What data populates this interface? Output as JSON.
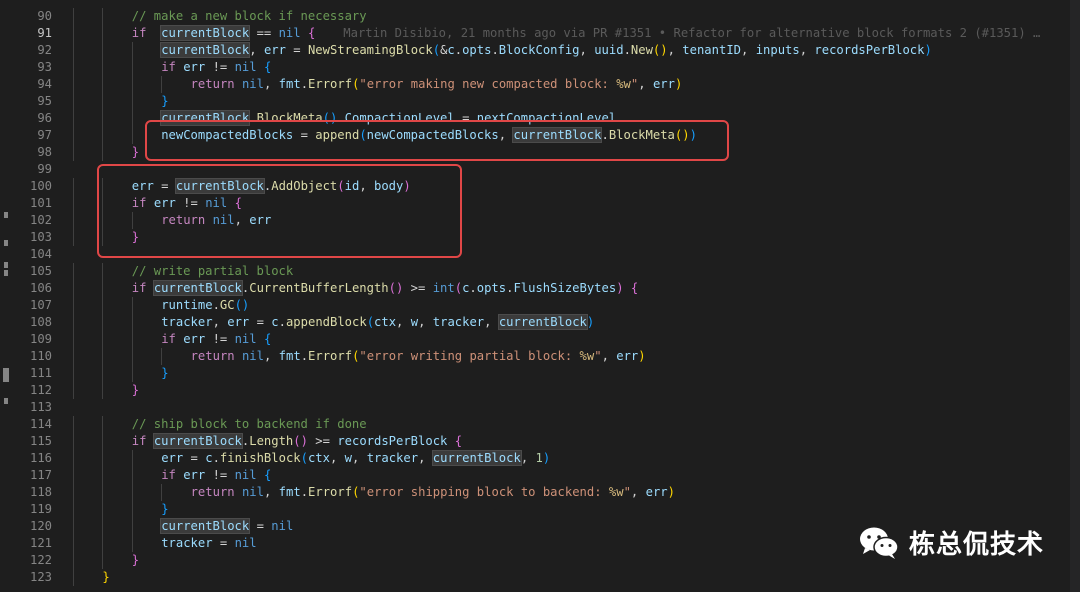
{
  "watermark": {
    "text": "栋总侃技术",
    "icon": "wechat-icon"
  },
  "blame": "Martin Disibio, 21 months ago via PR #1351 • Refactor for alternative block formats 2 (#1351) …",
  "lines": [
    {
      "n": "90",
      "indent": 2,
      "t": [
        [
          "cmt",
          "// make a new block if necessary"
        ]
      ]
    },
    {
      "n": "91",
      "indent": 2,
      "active": true,
      "t": [
        [
          "ctl",
          "if"
        ],
        [
          "",
          "  "
        ],
        [
          "var hl",
          "currentBlock"
        ],
        [
          "",
          " == "
        ],
        [
          "kw",
          "nil"
        ],
        [
          "",
          " "
        ],
        [
          "br2",
          "{"
        ]
      ],
      "blame": true
    },
    {
      "n": "92",
      "indent": 3,
      "t": [
        [
          "var hl",
          "currentBlock"
        ],
        [
          "",
          ", "
        ],
        [
          "var",
          "err"
        ],
        [
          "",
          " = "
        ],
        [
          "fn",
          "NewStreamingBlock"
        ],
        [
          "br3",
          "("
        ],
        [
          "",
          "&"
        ],
        [
          "var",
          "c"
        ],
        [
          "",
          "."
        ],
        [
          "var",
          "opts"
        ],
        [
          "",
          "."
        ],
        [
          "var",
          "BlockConfig"
        ],
        [
          "",
          ", "
        ],
        [
          "var",
          "uuid"
        ],
        [
          "",
          "."
        ],
        [
          "fn",
          "New"
        ],
        [
          "br1",
          "()"
        ],
        [
          "",
          ", "
        ],
        [
          "var",
          "tenantID"
        ],
        [
          "",
          ", "
        ],
        [
          "var",
          "inputs"
        ],
        [
          "",
          ", "
        ],
        [
          "var",
          "recordsPerBlock"
        ],
        [
          "br3",
          ")"
        ]
      ]
    },
    {
      "n": "93",
      "indent": 3,
      "t": [
        [
          "ctl",
          "if"
        ],
        [
          "",
          " "
        ],
        [
          "var",
          "err"
        ],
        [
          "",
          " != "
        ],
        [
          "kw",
          "nil"
        ],
        [
          "",
          " "
        ],
        [
          "br3",
          "{"
        ]
      ]
    },
    {
      "n": "94",
      "indent": 4,
      "t": [
        [
          "ctl",
          "return"
        ],
        [
          "",
          " "
        ],
        [
          "kw",
          "nil"
        ],
        [
          "",
          ", "
        ],
        [
          "var",
          "fmt"
        ],
        [
          "",
          "."
        ],
        [
          "fn",
          "Errorf"
        ],
        [
          "br1",
          "("
        ],
        [
          "str",
          "\"error making new compacted block: "
        ],
        [
          "esc",
          "%w"
        ],
        [
          "str",
          "\""
        ],
        [
          "",
          ", "
        ],
        [
          "var",
          "err"
        ],
        [
          "br1",
          ")"
        ]
      ]
    },
    {
      "n": "95",
      "indent": 3,
      "t": [
        [
          "br3",
          "}"
        ]
      ]
    },
    {
      "n": "96",
      "indent": 3,
      "t": [
        [
          "var hl",
          "currentBlock"
        ],
        [
          "",
          "."
        ],
        [
          "fn",
          "BlockMeta"
        ],
        [
          "br3",
          "()"
        ],
        [
          "",
          "."
        ],
        [
          "var",
          "CompactionLevel"
        ],
        [
          "",
          " = "
        ],
        [
          "var",
          "nextCompactionLevel"
        ]
      ]
    },
    {
      "n": "97",
      "indent": 3,
      "t": [
        [
          "var",
          "newCompactedBlocks"
        ],
        [
          "",
          " = "
        ],
        [
          "fn",
          "append"
        ],
        [
          "br3",
          "("
        ],
        [
          "var",
          "newCompactedBlocks"
        ],
        [
          "",
          ", "
        ],
        [
          "var hl",
          "currentBlock"
        ],
        [
          "",
          "."
        ],
        [
          "fn",
          "BlockMeta"
        ],
        [
          "br1",
          "()"
        ],
        [
          "br3",
          ")"
        ]
      ]
    },
    {
      "n": "98",
      "indent": 2,
      "t": [
        [
          "br2",
          "}"
        ]
      ]
    },
    {
      "n": "99",
      "indent": 0,
      "t": []
    },
    {
      "n": "100",
      "indent": 2,
      "t": [
        [
          "var",
          "err"
        ],
        [
          "",
          " = "
        ],
        [
          "var hl",
          "currentBlock"
        ],
        [
          "",
          "."
        ],
        [
          "fn",
          "AddObject"
        ],
        [
          "br2",
          "("
        ],
        [
          "var",
          "id"
        ],
        [
          "",
          ", "
        ],
        [
          "var",
          "body"
        ],
        [
          "br2",
          ")"
        ]
      ]
    },
    {
      "n": "101",
      "indent": 2,
      "t": [
        [
          "ctl",
          "if"
        ],
        [
          "",
          " "
        ],
        [
          "var",
          "err"
        ],
        [
          "",
          " != "
        ],
        [
          "kw",
          "nil"
        ],
        [
          "",
          " "
        ],
        [
          "br2",
          "{"
        ]
      ]
    },
    {
      "n": "102",
      "indent": 3,
      "t": [
        [
          "ctl",
          "return"
        ],
        [
          "",
          " "
        ],
        [
          "kw",
          "nil"
        ],
        [
          "",
          ", "
        ],
        [
          "var",
          "err"
        ]
      ]
    },
    {
      "n": "103",
      "indent": 2,
      "t": [
        [
          "br2",
          "}"
        ]
      ]
    },
    {
      "n": "104",
      "indent": 0,
      "t": []
    },
    {
      "n": "105",
      "indent": 2,
      "t": [
        [
          "cmt",
          "// write partial block"
        ]
      ]
    },
    {
      "n": "106",
      "indent": 2,
      "t": [
        [
          "ctl",
          "if"
        ],
        [
          "",
          " "
        ],
        [
          "var hl",
          "currentBlock"
        ],
        [
          "",
          "."
        ],
        [
          "fn",
          "CurrentBufferLength"
        ],
        [
          "br2",
          "()"
        ],
        [
          "",
          " >= "
        ],
        [
          "kw",
          "int"
        ],
        [
          "br2",
          "("
        ],
        [
          "var",
          "c"
        ],
        [
          "",
          "."
        ],
        [
          "var",
          "opts"
        ],
        [
          "",
          "."
        ],
        [
          "var",
          "FlushSizeBytes"
        ],
        [
          "br2",
          ")"
        ],
        [
          "",
          " "
        ],
        [
          "br2",
          "{"
        ]
      ]
    },
    {
      "n": "107",
      "indent": 3,
      "t": [
        [
          "var",
          "runtime"
        ],
        [
          "",
          "."
        ],
        [
          "fn",
          "GC"
        ],
        [
          "br3",
          "()"
        ]
      ]
    },
    {
      "n": "108",
      "indent": 3,
      "t": [
        [
          "var",
          "tracker"
        ],
        [
          "",
          ", "
        ],
        [
          "var",
          "err"
        ],
        [
          "",
          " = "
        ],
        [
          "var",
          "c"
        ],
        [
          "",
          "."
        ],
        [
          "fn",
          "appendBlock"
        ],
        [
          "br3",
          "("
        ],
        [
          "var",
          "ctx"
        ],
        [
          "",
          ", "
        ],
        [
          "var",
          "w"
        ],
        [
          "",
          ", "
        ],
        [
          "var",
          "tracker"
        ],
        [
          "",
          ", "
        ],
        [
          "var hl",
          "currentBlock"
        ],
        [
          "br3",
          ")"
        ]
      ]
    },
    {
      "n": "109",
      "indent": 3,
      "t": [
        [
          "ctl",
          "if"
        ],
        [
          "",
          " "
        ],
        [
          "var",
          "err"
        ],
        [
          "",
          " != "
        ],
        [
          "kw",
          "nil"
        ],
        [
          "",
          " "
        ],
        [
          "br3",
          "{"
        ]
      ]
    },
    {
      "n": "110",
      "indent": 4,
      "t": [
        [
          "ctl",
          "return"
        ],
        [
          "",
          " "
        ],
        [
          "kw",
          "nil"
        ],
        [
          "",
          ", "
        ],
        [
          "var",
          "fmt"
        ],
        [
          "",
          "."
        ],
        [
          "fn",
          "Errorf"
        ],
        [
          "br1",
          "("
        ],
        [
          "str",
          "\"error writing partial block: "
        ],
        [
          "esc",
          "%w"
        ],
        [
          "str",
          "\""
        ],
        [
          "",
          ", "
        ],
        [
          "var",
          "err"
        ],
        [
          "br1",
          ")"
        ]
      ]
    },
    {
      "n": "111",
      "indent": 3,
      "t": [
        [
          "br3",
          "}"
        ]
      ]
    },
    {
      "n": "112",
      "indent": 2,
      "t": [
        [
          "br2",
          "}"
        ]
      ]
    },
    {
      "n": "113",
      "indent": 0,
      "t": []
    },
    {
      "n": "114",
      "indent": 2,
      "t": [
        [
          "cmt",
          "// ship block to backend if done"
        ]
      ]
    },
    {
      "n": "115",
      "indent": 2,
      "t": [
        [
          "ctl",
          "if"
        ],
        [
          "",
          " "
        ],
        [
          "var hl",
          "currentBlock"
        ],
        [
          "",
          "."
        ],
        [
          "fn",
          "Length"
        ],
        [
          "br2",
          "()"
        ],
        [
          "",
          " >= "
        ],
        [
          "var",
          "recordsPerBlock"
        ],
        [
          "",
          " "
        ],
        [
          "br2",
          "{"
        ]
      ]
    },
    {
      "n": "116",
      "indent": 3,
      "t": [
        [
          "var",
          "err"
        ],
        [
          "",
          " = "
        ],
        [
          "var",
          "c"
        ],
        [
          "",
          "."
        ],
        [
          "fn",
          "finishBlock"
        ],
        [
          "br3",
          "("
        ],
        [
          "var",
          "ctx"
        ],
        [
          "",
          ", "
        ],
        [
          "var",
          "w"
        ],
        [
          "",
          ", "
        ],
        [
          "var",
          "tracker"
        ],
        [
          "",
          ", "
        ],
        [
          "var hl",
          "currentBlock"
        ],
        [
          "",
          ", "
        ],
        [
          "num",
          "1"
        ],
        [
          "br3",
          ")"
        ]
      ]
    },
    {
      "n": "117",
      "indent": 3,
      "t": [
        [
          "ctl",
          "if"
        ],
        [
          "",
          " "
        ],
        [
          "var",
          "err"
        ],
        [
          "",
          " != "
        ],
        [
          "kw",
          "nil"
        ],
        [
          "",
          " "
        ],
        [
          "br3",
          "{"
        ]
      ]
    },
    {
      "n": "118",
      "indent": 4,
      "t": [
        [
          "ctl",
          "return"
        ],
        [
          "",
          " "
        ],
        [
          "kw",
          "nil"
        ],
        [
          "",
          ", "
        ],
        [
          "var",
          "fmt"
        ],
        [
          "",
          "."
        ],
        [
          "fn",
          "Errorf"
        ],
        [
          "br1",
          "("
        ],
        [
          "str",
          "\"error shipping block to backend: "
        ],
        [
          "esc",
          "%w"
        ],
        [
          "str",
          "\""
        ],
        [
          "",
          ", "
        ],
        [
          "var",
          "err"
        ],
        [
          "br1",
          ")"
        ]
      ]
    },
    {
      "n": "119",
      "indent": 3,
      "t": [
        [
          "br3",
          "}"
        ]
      ]
    },
    {
      "n": "120",
      "indent": 3,
      "t": [
        [
          "var hl",
          "currentBlock"
        ],
        [
          "",
          " = "
        ],
        [
          "kw",
          "nil"
        ]
      ]
    },
    {
      "n": "121",
      "indent": 3,
      "t": [
        [
          "var",
          "tracker"
        ],
        [
          "",
          " = "
        ],
        [
          "kw",
          "nil"
        ]
      ]
    },
    {
      "n": "122",
      "indent": 2,
      "t": [
        [
          "br2",
          "}"
        ]
      ]
    },
    {
      "n": "123",
      "indent": 1,
      "t": [
        [
          "br1",
          "}"
        ]
      ]
    }
  ]
}
